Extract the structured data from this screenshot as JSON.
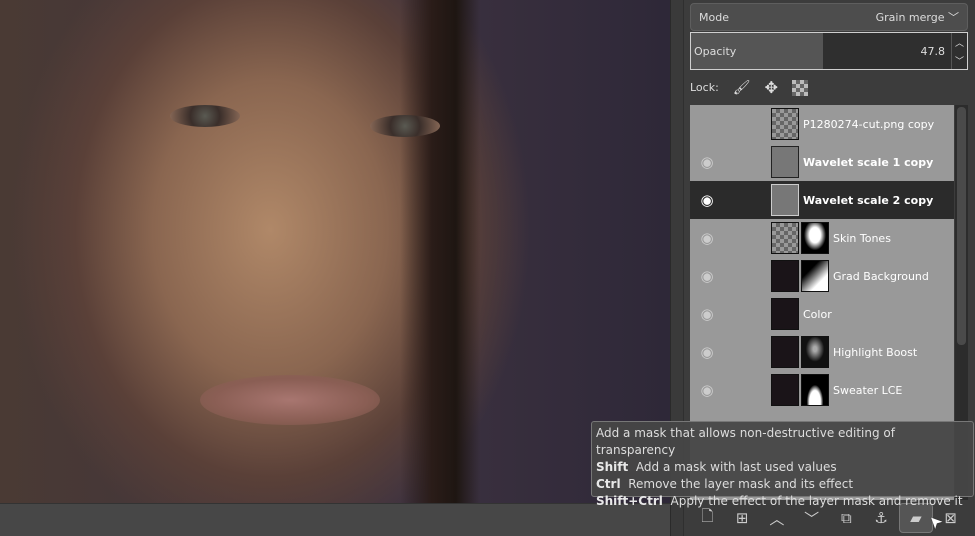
{
  "layer_options": {
    "mode_label": "Mode",
    "mode_value": "Grain merge",
    "opacity_label": "Opacity",
    "opacity_value": "47.8",
    "opacity_percent": 47.8,
    "lock_label": "Lock:"
  },
  "layers": [
    {
      "name": "P1280274-cut.png copy",
      "visible": false,
      "bold": false,
      "selected": false
    },
    {
      "name": "Wavelet scale 1 copy",
      "visible": true,
      "bold": true,
      "selected": false
    },
    {
      "name": "Wavelet scale 2 copy",
      "visible": true,
      "bold": true,
      "selected": true
    },
    {
      "name": "Skin Tones",
      "visible": true,
      "bold": false,
      "selected": false
    },
    {
      "name": "Grad Background",
      "visible": true,
      "bold": false,
      "selected": false
    },
    {
      "name": "Color",
      "visible": true,
      "bold": false,
      "selected": false
    },
    {
      "name": "Highlight Boost",
      "visible": true,
      "bold": false,
      "selected": false
    },
    {
      "name": "Sweater LCE",
      "visible": true,
      "bold": false,
      "selected": false
    }
  ],
  "tooltip": {
    "line1": "Add a mask that allows non-destructive editing of transparency",
    "line2_key": "Shift",
    "line2": "Add a mask with last used values",
    "line3_key": "Ctrl",
    "line3": "Remove the layer mask and its effect",
    "line4_key": "Shift+Ctrl",
    "line4": "Apply the effect of the layer mask and remove it"
  },
  "icons": {
    "eye": "👁",
    "chevron": "⌄"
  }
}
